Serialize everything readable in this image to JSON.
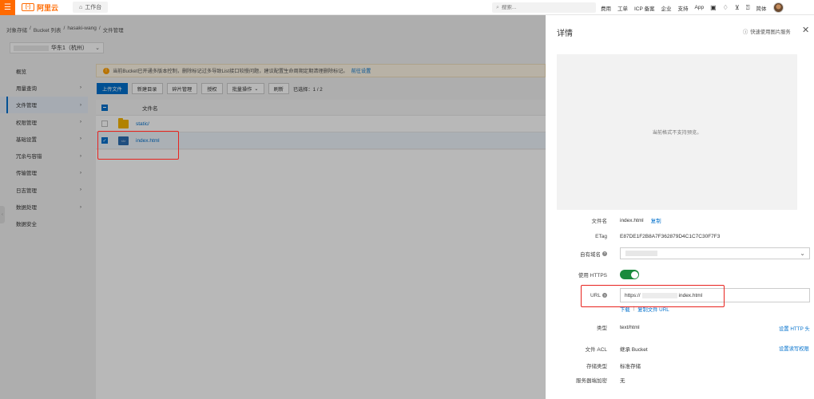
{
  "topbar": {
    "logo_text": "阿里云",
    "workbench_label": "工作台",
    "search_placeholder": "搜索...",
    "nav": [
      "费用",
      "工单",
      "ICP 备案",
      "企业",
      "支持",
      "App"
    ],
    "lang_label": "简体"
  },
  "breadcrumb": [
    "对象存储",
    "/",
    "Bucket 列表",
    "/",
    "hasaki-wang",
    "/",
    "文件管理"
  ],
  "region": {
    "label": "华东1（杭州）"
  },
  "sidebar": {
    "items": [
      {
        "label": "概览",
        "arrow": ""
      },
      {
        "label": "用量查询",
        "arrow": "›"
      },
      {
        "label": "文件管理",
        "arrow": "›"
      },
      {
        "label": "权限管理",
        "arrow": "›"
      },
      {
        "label": "基础设置",
        "arrow": "›"
      },
      {
        "label": "冗余与容错",
        "arrow": "›"
      },
      {
        "label": "传输管理",
        "arrow": "›"
      },
      {
        "label": "日志管理",
        "arrow": "›"
      },
      {
        "label": "数据处理",
        "arrow": "›"
      },
      {
        "label": "数据安全",
        "arrow": ""
      }
    ]
  },
  "notice": {
    "text": "当前Bucket已开通多版本控制，删除标记过多导致List接口较慢问题，建议配置生命周期定期清理删除标记。",
    "link": "前往设置"
  },
  "toolbar": {
    "upload": "上传文件",
    "new_dir": "新建目录",
    "fragments": "碎片管理",
    "authorize": "授权",
    "batch": "批量操作",
    "refresh": "刷新",
    "selected": "已选择：1 / 2"
  },
  "files": {
    "header": "文件名",
    "rows": [
      {
        "name": "static/"
      },
      {
        "name": "index.html"
      }
    ]
  },
  "panel": {
    "title": "详情",
    "help": "快速使用图片服务",
    "preview_text": "当前格式不支持预览。",
    "fields": {
      "filename_label": "文件名",
      "filename_value": "index.html",
      "copy": "复制",
      "etag_label": "ETag",
      "etag_value": "E87DE1F2B8A7F362879D4C1C7C30F7F3",
      "domain_label": "自有域名",
      "https_label": "使用 HTTPS",
      "url_label": "URL",
      "url_prefix": "https://",
      "url_suffix": "index.html",
      "download": "下载",
      "copy_url": "复制文件 URL",
      "type_label": "类型",
      "type_value": "text/html",
      "set_http": "设置 HTTP 头",
      "acl_label": "文件 ACL",
      "acl_value": "继承 Bucket",
      "set_acl": "设置读写权限",
      "storage_label": "存储类型",
      "storage_value": "标准存储",
      "encryption_label": "服务器端加密",
      "encryption_value": "无"
    }
  },
  "colors": {
    "brand": "#ff6a00",
    "link": "#0070cc",
    "highlight": "#e8231e",
    "toggle_on": "#1a8a3c"
  }
}
